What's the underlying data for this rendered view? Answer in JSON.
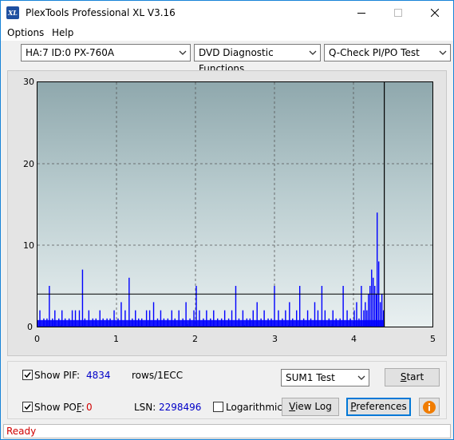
{
  "window": {
    "title": "PlexTools Professional XL V3.16",
    "icon_text": "XL"
  },
  "menu": {
    "options_label": "Options",
    "help_label": "Help"
  },
  "toolbar": {
    "drive": "HA:7 ID:0  PX-760A",
    "function": "DVD Diagnostic Functions",
    "test": "Q-Check PI/PO Test"
  },
  "chart_data": {
    "type": "bar",
    "title": "",
    "xlabel": "",
    "ylabel": "",
    "xlim": [
      0,
      5
    ],
    "ylim": [
      0,
      30
    ],
    "x_ticks": [
      "0",
      "1",
      "2",
      "3",
      "4",
      "5"
    ],
    "y_ticks": [
      "0",
      "10",
      "20",
      "30"
    ],
    "grid": true,
    "threshold": 4,
    "end_marker_x": 4.39,
    "series": [
      {
        "bar_color": "#0000ff",
        "x": [
          0.03,
          0.08,
          0.12,
          0.15,
          0.19,
          0.22,
          0.27,
          0.31,
          0.35,
          0.4,
          0.44,
          0.48,
          0.53,
          0.57,
          0.6,
          0.65,
          0.7,
          0.74,
          0.79,
          0.83,
          0.88,
          0.92,
          0.97,
          1.02,
          1.06,
          1.11,
          1.16,
          1.2,
          1.24,
          1.28,
          1.32,
          1.38,
          1.42,
          1.47,
          1.52,
          1.56,
          1.6,
          1.65,
          1.7,
          1.74,
          1.79,
          1.84,
          1.88,
          1.93,
          1.98,
          2.01,
          2.05,
          2.1,
          2.14,
          2.19,
          2.23,
          2.28,
          2.33,
          2.37,
          2.42,
          2.46,
          2.51,
          2.55,
          2.6,
          2.65,
          2.69,
          2.73,
          2.78,
          2.83,
          2.87,
          2.92,
          2.96,
          3.0,
          3.05,
          3.1,
          3.14,
          3.19,
          3.23,
          3.28,
          3.32,
          3.37,
          3.42,
          3.46,
          3.51,
          3.55,
          3.6,
          3.64,
          3.69,
          3.74,
          3.78,
          3.83,
          3.87,
          3.92,
          3.96,
          4.01,
          4.04,
          4.07,
          4.1,
          4.13,
          4.15,
          4.17,
          4.19,
          4.21,
          4.23,
          4.25,
          4.27,
          4.29,
          4.3,
          4.32,
          4.34,
          4.36,
          4.38
        ],
        "values": [
          2,
          1,
          1,
          5,
          1,
          2,
          1,
          2,
          1,
          1,
          2,
          2,
          2,
          7,
          1,
          2,
          1,
          1,
          2,
          1,
          1,
          1,
          2,
          1,
          3,
          2,
          6,
          1,
          2,
          1,
          1,
          2,
          2,
          3,
          1,
          2,
          1,
          1,
          2,
          1,
          2,
          1,
          3,
          1,
          2,
          5,
          2,
          1,
          2,
          1,
          2,
          1,
          1,
          2,
          1,
          2,
          5,
          1,
          2,
          1,
          1,
          2,
          3,
          1,
          2,
          1,
          1,
          5,
          2,
          1,
          2,
          3,
          1,
          2,
          5,
          1,
          2,
          1,
          3,
          2,
          5,
          2,
          1,
          2,
          1,
          1,
          5,
          2,
          1,
          2,
          3,
          1,
          5,
          2,
          3,
          2,
          4,
          5,
          7,
          6,
          5,
          4,
          14,
          8,
          3,
          4,
          2
        ]
      },
      {
        "bar_color": "#00a000",
        "x": [
          0.3,
          0.75,
          1.42,
          1.9,
          2.62,
          3.18,
          3.73,
          4.22
        ],
        "values": [
          0.2,
          0.2,
          0.2,
          0.3,
          0.2,
          0.2,
          0.3,
          0.2
        ]
      }
    ]
  },
  "bottom": {
    "show_pif_label": "Show PIF:",
    "pif_value": "4834",
    "pif_unit": "rows/1ECC",
    "show_pof_label_pre": "Show PO",
    "show_pof_label_ul": "F",
    "show_pof_label_post": ":",
    "pof_value": "0",
    "lsn_label": "LSN:",
    "lsn_value": "2298496",
    "logarithmic_label": "Logarithmic",
    "sum_test": "SUM1 Test",
    "start_label_ul": "S",
    "start_label_rest": "tart",
    "view_log_label_ul": "V",
    "view_log_label_rest": "iew Log",
    "preferences_label_ul": "P",
    "preferences_label_rest": "references",
    "show_pif_checked": true,
    "show_pof_checked": true,
    "logarithmic_checked": false
  },
  "status": {
    "text": "Ready"
  },
  "colors": {
    "accent": "#0078d7",
    "bar": "#0000ff",
    "status_text": "#d00000"
  }
}
